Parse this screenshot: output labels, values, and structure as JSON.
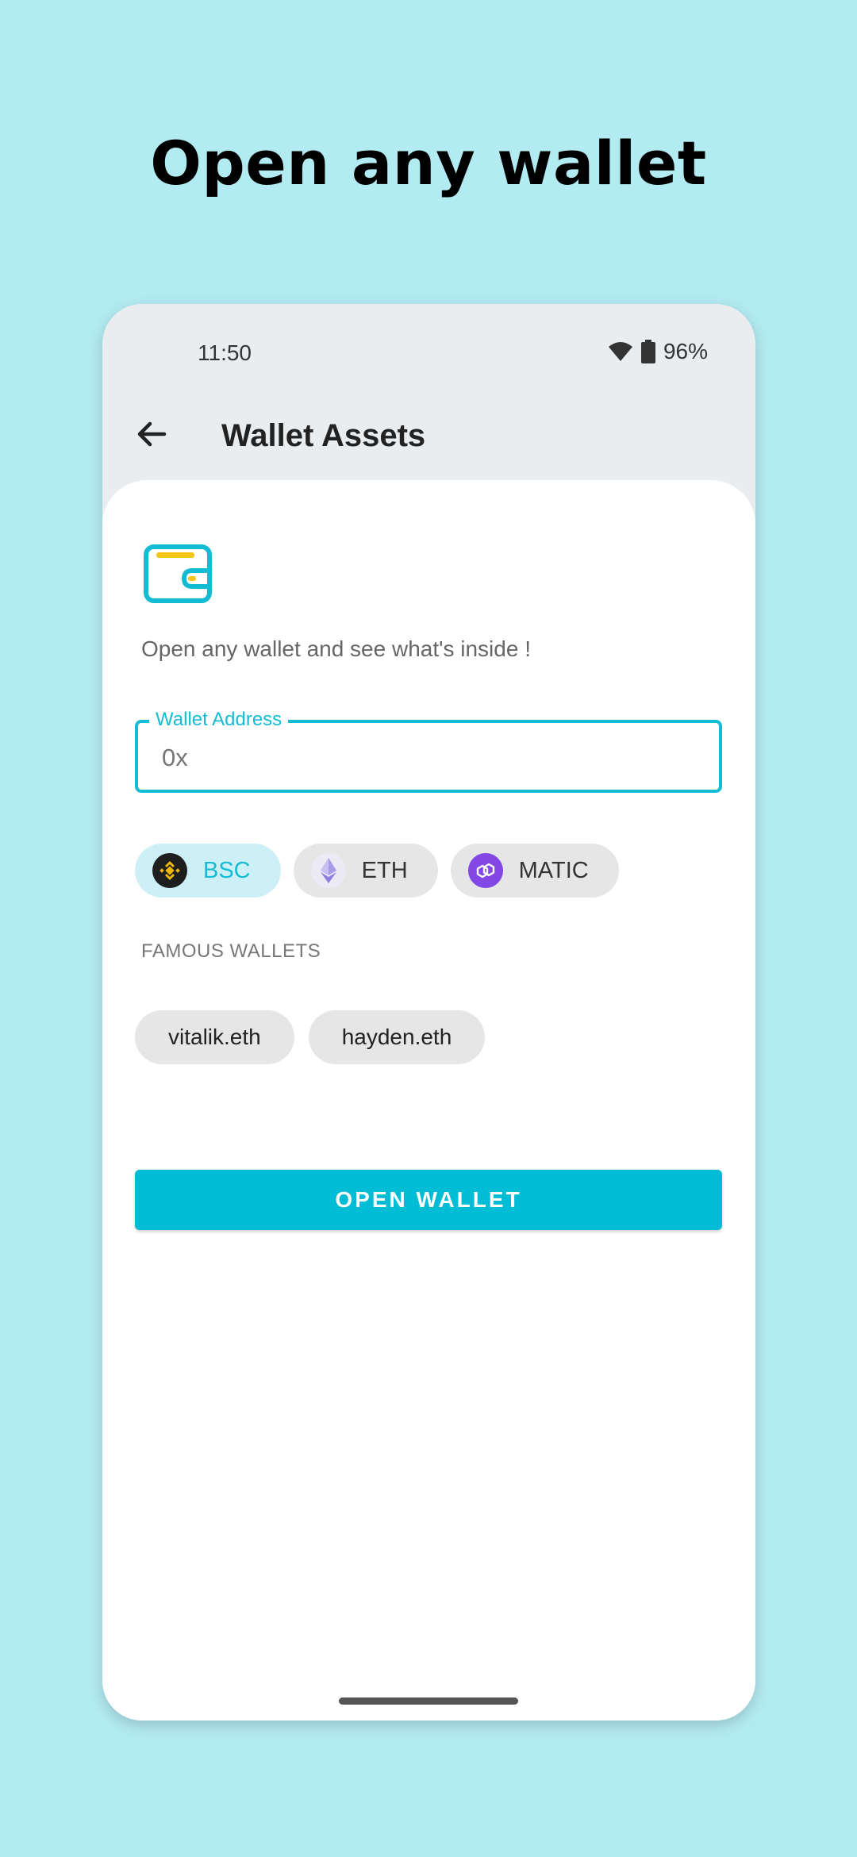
{
  "promo": {
    "headline": "Open any wallet"
  },
  "status_bar": {
    "time": "11:50",
    "battery": "96%",
    "icons": [
      "wifi-icon",
      "battery-icon"
    ]
  },
  "app_bar": {
    "title": "Wallet Assets",
    "back_icon": "arrow-left-icon"
  },
  "content": {
    "wallet_icon": "wallet-icon",
    "subtitle": "Open any wallet and see what's inside !",
    "address_field": {
      "label": "Wallet Address",
      "value": "0x",
      "placeholder": ""
    },
    "chains": [
      {
        "label": "BSC",
        "icon": "bnb-icon",
        "selected": true
      },
      {
        "label": "ETH",
        "icon": "ethereum-icon",
        "selected": false
      },
      {
        "label": "MATIC",
        "icon": "polygon-icon",
        "selected": false
      }
    ],
    "famous_wallets_label": "FAMOUS WALLETS",
    "famous_wallets": [
      "vitalik.eth",
      "hayden.eth"
    ],
    "open_button": "OPEN WALLET"
  },
  "colors": {
    "background": "#b3ebf2",
    "accent": "#00bcd4",
    "chip_selected_bg": "#cdf0f6",
    "chip_bg": "#e6e6e6",
    "wallet_icon_stripe": "#f5c518"
  }
}
